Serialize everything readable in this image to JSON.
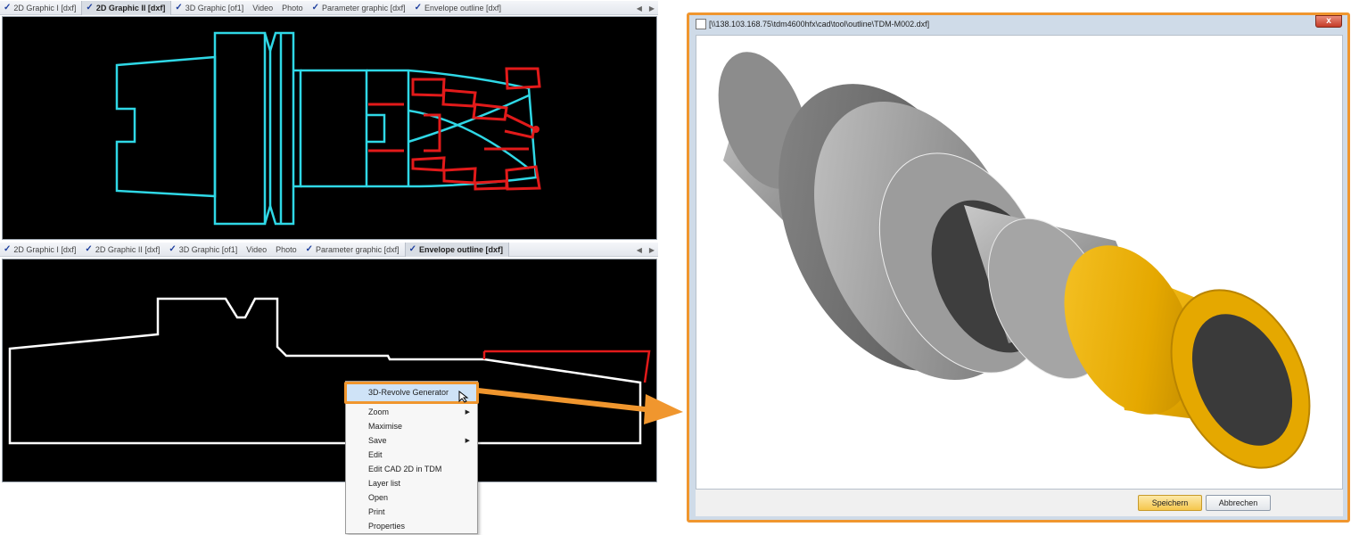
{
  "top_panel": {
    "tabs": [
      {
        "label": "2D Graphic I [dxf]",
        "checked": true,
        "active": false
      },
      {
        "label": "2D Graphic  II [dxf]",
        "checked": true,
        "active": true
      },
      {
        "label": "3D Graphic [of1]",
        "checked": true,
        "active": false
      },
      {
        "label": "Video",
        "checked": false,
        "active": false
      },
      {
        "label": "Photo",
        "checked": false,
        "active": false
      },
      {
        "label": "Parameter graphic [dxf]",
        "checked": true,
        "active": false
      },
      {
        "label": "Envelope outline [dxf]",
        "checked": true,
        "active": false
      }
    ]
  },
  "bottom_panel": {
    "tabs": [
      {
        "label": "2D Graphic I [dxf]",
        "checked": true,
        "active": false
      },
      {
        "label": "2D Graphic  II [dxf]",
        "checked": true,
        "active": false
      },
      {
        "label": "3D Graphic [of1]",
        "checked": true,
        "active": false
      },
      {
        "label": "Video",
        "checked": false,
        "active": false
      },
      {
        "label": "Photo",
        "checked": false,
        "active": false
      },
      {
        "label": "Parameter graphic [dxf]",
        "checked": true,
        "active": false
      },
      {
        "label": "Envelope outline [dxf]",
        "checked": true,
        "active": true
      }
    ]
  },
  "context_menu": {
    "items": [
      {
        "label": "3D-Revolve Generator",
        "submenu": false,
        "highlighted": true
      },
      {
        "label": "Zoom",
        "submenu": true
      },
      {
        "label": "Maximise",
        "submenu": false
      },
      {
        "label": "Save",
        "submenu": true
      },
      {
        "label": "Edit",
        "submenu": false
      },
      {
        "label": "Edit CAD 2D in TDM",
        "submenu": false
      },
      {
        "label": "Layer list",
        "submenu": false
      },
      {
        "label": "Open",
        "submenu": false
      },
      {
        "label": "Print",
        "submenu": false
      },
      {
        "label": "Properties",
        "submenu": false
      }
    ]
  },
  "dialog": {
    "title": "[\\\\138.103.168.75\\tdm4600hfx\\cad\\tool\\outline\\TDM-M002.dxf]",
    "close_label": "x",
    "save_label": "Speichern",
    "cancel_label": "Abbrechen"
  },
  "colors": {
    "accent": "#f0962e",
    "cad_cyan": "#2fd8e6",
    "cad_red": "#e21a1a",
    "cutter_gold": "#f0b400"
  },
  "icons": {
    "tab_check": "✓",
    "nav_left": "◀",
    "nav_right": "▶",
    "submenu": "▶"
  }
}
